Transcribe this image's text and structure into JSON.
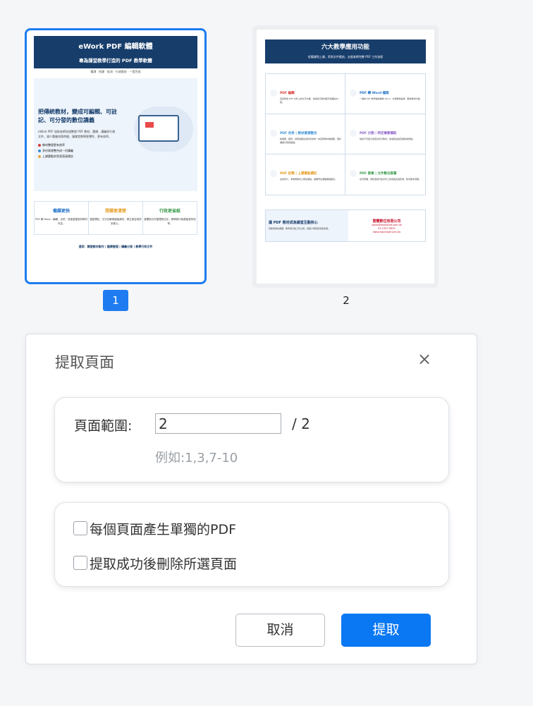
{
  "thumbnails": {
    "page1": {
      "number": "1",
      "title": "eWork PDF 編輯軟體",
      "subtitle": "專為課堂教學打造的 PDF 教學軟體",
      "tagline": "備課 · 授課 · 批改 · 行政簽核 · 一套完成",
      "hero_heading": "把傳統教材，變成可編輯、可註記、可分發的數位講義",
      "hero_desc": "eWork PDF 協助老師快速整理 PDF 教材、題庫、講義與行政文件，減少重複排版時間，讓課堂教學更彈性、更有效率。",
      "bullets": [
        "教材整理更有效率",
        "多份資源整合成一份講義",
        "上課重點與答案直接標註"
      ],
      "bullet_colors": [
        "#d63b3b",
        "#3a8fd6",
        "#e8a23b"
      ],
      "columns": [
        {
          "title": "備課更快",
          "desc": "PDF 轉 Word、編輯、合併，快速重整既有教材內容。",
          "color": "#1e6fc8"
        },
        {
          "title": "授課更清楚",
          "desc": "重點標記、文字註解與圖面補充，學生更容易抓到核心。",
          "color": "#e49b1e"
        },
        {
          "title": "行政更省紙",
          "desc": "簽署與文件整理數位化，教學與行政都能更有效率。",
          "color": "#3a9a4c"
        }
      ],
      "footer": "適用：課堂教材製作 | 題庫整理 | 講義分發 | 教學行政文件"
    },
    "page2": {
      "number": "2",
      "title": "六大教學應用功能",
      "subtitle": "從備課到上課，再到文件簽核，支援老師完整 PDF 工作流程",
      "features": [
        {
          "title": "PDF 編輯",
          "desc": "直接修改 PDF 文件上的文字內容，快速修正教材錯字與補充內容。",
          "color": "#d63b3b"
        },
        {
          "title": "PDF 轉 Word 檔案",
          "desc": "一鍵將 PDF 教學檔案轉成 Word，方便重新編排、更新教材內容。",
          "color": "#1e6fc8"
        },
        {
          "title": "PDF 合併 | 教材資源整合",
          "desc": "將講義、練習、試題與補充資料合併成一本完整教材或講義，便於課堂分發與閱讀。",
          "color": "#3a8fd6"
        },
        {
          "title": "PDF 分割 | 特定章節擷取",
          "desc": "依據不同單元或週次拆分教材，快速取出指定章節或題組。",
          "color": "#8a5cc8"
        },
        {
          "title": "PDF 註釋 | 上課重點標記",
          "desc": "在投影片、考卷或教材上標註重點，提醒學生課堂關鍵觀念。",
          "color": "#e49b1e"
        },
        {
          "title": "PDF 簽章 | 文件數位簽署",
          "desc": "在同意書、通知單與行政文件上完成簽名與核准，節省紙本流程。",
          "color": "#3a9a4c"
        }
      ],
      "bottom_title": "讓 PDF 教材成為課堂互動核心",
      "bottom_desc": "幫助老師在備課、教學與行政工作之間，用更少時間完成更多事。",
      "company": "雷霆數位有限公司",
      "email": "sales@eworkpdf.com.tw",
      "phone": "02-2357-9831",
      "website": "www.eworkpdf.com.tw"
    }
  },
  "dialog": {
    "title": "提取頁面",
    "close_icon": "close-icon",
    "range_label": "頁面範圍:",
    "range_value": "2",
    "range_total": "/ 2",
    "range_hint": "例如:1,3,7-10",
    "option_separate": "每個頁面產生單獨的PDF",
    "option_delete": "提取成功後刪除所選頁面",
    "cancel_label": "取消",
    "extract_label": "提取"
  },
  "colors": {
    "accent": "#0a78f2",
    "selected_border": "#1e7cf0",
    "banner": "#173d6b"
  }
}
